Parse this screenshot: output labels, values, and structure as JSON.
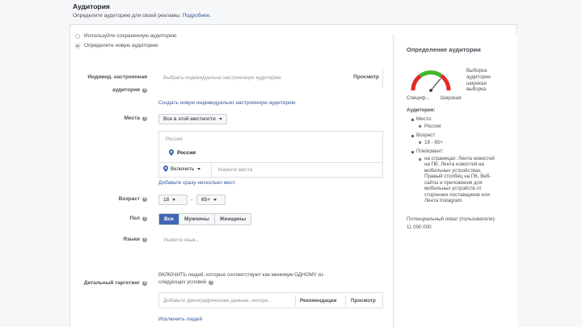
{
  "header": {
    "title": "Аудитория",
    "subtitle": "Определите аудиторию для своей рекламы.",
    "more_link": "Подробнее."
  },
  "audience_choice": {
    "options": [
      {
        "label": "Используйте сохраненную аудиторию",
        "selected": false
      },
      {
        "label": "Определите новую аудиторию",
        "selected": true
      }
    ]
  },
  "custom_audience": {
    "label_line1": "Индивид. настроенная",
    "label_line2": "аудитория",
    "placeholder": "Выбрать индивидуально настроенную аудиторию",
    "browse": "Просмотр",
    "create_link": "Создать новую индивидуально настроенную аудиторию"
  },
  "locations": {
    "label": "Места",
    "dropdown": "Все в этой местности",
    "group_title": "Россия",
    "selected_item": "Россия",
    "include_dropdown": "Включить",
    "search_placeholder": "Укажите места",
    "bulk_link": "Добавьте сразу несколько мест."
  },
  "age": {
    "label": "Возраст",
    "min": "18",
    "separator": "-",
    "max": "65+"
  },
  "gender": {
    "label": "Пол",
    "options": [
      "Все",
      "Мужчины",
      "Женщины"
    ],
    "selected_index": 0
  },
  "languages": {
    "label": "Языки",
    "placeholder": "Укажите язык..."
  },
  "detailed_targeting": {
    "label": "Детальный таргетинг",
    "include_text_line1": "ВКЛЮЧИТЬ людей, которые соответствуют как минимум ОДНОМУ из",
    "include_text_line2": "следующих условий",
    "placeholder": "Добавьте демографические данные, интере...",
    "suggestions": "Рекомендации",
    "browse": "Просмотр",
    "exclude_link": "Исключить людей"
  },
  "sidebar": {
    "title": "Определение аудитории",
    "gauge_left": "Специф...",
    "gauge_right": "Широкая",
    "gauge_note": [
      "Выборка",
      "аудитории",
      "широкая",
      "выборка"
    ],
    "gauge_level": 0.72,
    "audience_heading": "Аудитория:",
    "location_heading": "Место:",
    "location_value": "Россия",
    "age_heading": "Возраст:",
    "age_value": "18 - 65+",
    "placements_heading": "Плейсмент:",
    "placements_lines": [
      "на страницах: Лента новостей",
      "на ПК, Лента новостей на",
      "мобильных устройствах,",
      "Правый столбец на ПК, Веб-",
      "сайты и приложения для",
      "мобильных устройств от",
      "сторонних поставщиков или",
      "Лента Instagram"
    ],
    "reach_label": "Потенциальный охват (пользователи):",
    "reach_value": "11 000 000"
  },
  "colors": {
    "link": "#365899",
    "accent": "#4267b2",
    "gauge_green": "#42b72a",
    "gauge_yellow": "#f7b928",
    "gauge_red": "#e02b27"
  }
}
